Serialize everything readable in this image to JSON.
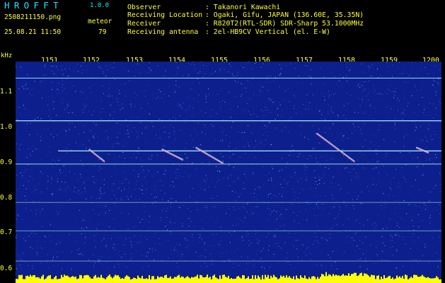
{
  "header": {
    "app_name": "HROFFT",
    "app_version": "1.0.0",
    "filename": "2508211150.png",
    "datetime": "25.08.21 11:50",
    "meteor_label": "meteor",
    "meteor_count": "79",
    "info_rows": [
      {
        "label": "Observer",
        "value": ": Takanori Kawachi"
      },
      {
        "label": "Receiving Location",
        "value": ": Ogaki, Gifu, JAPAN (136.60E, 35.35N)"
      },
      {
        "label": "Receiver",
        "value": ": R820T2(RTL-SDR) SDR-Sharp 53.1000MHz"
      },
      {
        "label": "Receiving antenna",
        "value": ": 2el-HB9CV Vertical (el. E-W)"
      }
    ]
  },
  "spectrogram": {
    "y_unit": "kHz",
    "x_ticks": [
      "1151",
      "1152",
      "1153",
      "1154",
      "1155",
      "1156",
      "1157",
      "1158",
      "1159",
      "1200"
    ],
    "y_ticks": [
      "1.1",
      "1.0",
      "0.9",
      "0.8",
      "0.7",
      "0.6"
    ],
    "colors": {
      "text_primary": "#19e8ff",
      "text_accent": "#ffff38",
      "background": "#0d1f8c",
      "signal": "#b0ffff",
      "echo": "#ff6aa8",
      "noise_bar": "#ffff00"
    }
  },
  "chart_data": {
    "type": "heatmap",
    "x_axis_ticks": [
      "1151",
      "1152",
      "1153",
      "1154",
      "1155",
      "1156",
      "1157",
      "1158",
      "1159",
      "1200"
    ],
    "y_axis": {
      "unit": "kHz",
      "ticks": [
        1.1,
        1.0,
        0.9,
        0.8,
        0.7,
        0.6
      ],
      "range": [
        0.58,
        1.18
      ]
    },
    "horizontal_carriers_khz": [
      1.135,
      1.015,
      0.93,
      0.893,
      0.785,
      0.705,
      0.62
    ],
    "meteor_echoes": [
      {
        "x_start": 1151.98,
        "x_end": 1152.35,
        "f_start": 0.935,
        "f_end": 0.9
      },
      {
        "x_start": 1153.7,
        "x_end": 1154.2,
        "f_start": 0.935,
        "f_end": 0.905
      },
      {
        "x_start": 1154.5,
        "x_end": 1155.15,
        "f_start": 0.94,
        "f_end": 0.895
      },
      {
        "x_start": 1157.35,
        "x_end": 1158.25,
        "f_start": 0.98,
        "f_end": 0.9
      },
      {
        "x_start": 1159.7,
        "x_end": 1200.0,
        "f_start": 0.94,
        "f_end": 0.925
      }
    ]
  }
}
